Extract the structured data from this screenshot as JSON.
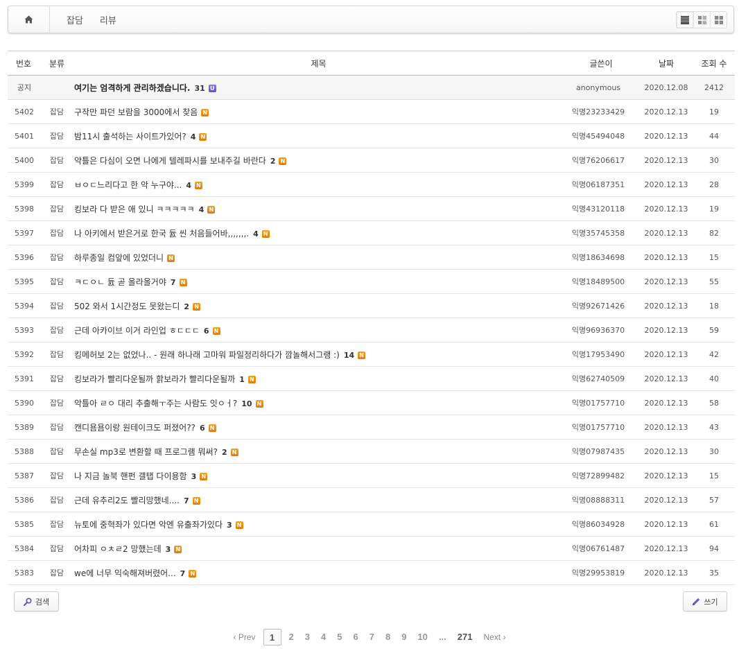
{
  "nav": {
    "home_icon": "home-icon",
    "categories": [
      "잡담",
      "리뷰"
    ],
    "view_modes": [
      {
        "name": "list-view",
        "icon": "list-icon",
        "active": true
      },
      {
        "name": "webzine-view",
        "icon": "webzine-icon",
        "active": false
      },
      {
        "name": "gallery-view",
        "icon": "gallery-icon",
        "active": false
      }
    ]
  },
  "table": {
    "headers": {
      "num": "번호",
      "category": "분류",
      "title": "제목",
      "author": "글쓴이",
      "date": "날짜",
      "views": "조회 수"
    },
    "notice": {
      "num": "공지",
      "category": "",
      "title": "여기는 엄격하게 관리하겠습니다.",
      "comments": "31",
      "badge": "U",
      "author": "anonymous",
      "date": "2020.12.08",
      "views": "2412"
    },
    "rows": [
      {
        "num": "5402",
        "category": "잡담",
        "title": "구작만 파던 보람을 3000에서 찾음",
        "comments": "",
        "badge": "N",
        "author": "익명23233429",
        "date": "2020.12.13",
        "views": "19"
      },
      {
        "num": "5401",
        "category": "잡담",
        "title": "밤11시 출석하는 사이트가있어?",
        "comments": "4",
        "badge": "N",
        "author": "익명45494048",
        "date": "2020.12.13",
        "views": "44"
      },
      {
        "num": "5400",
        "category": "잡담",
        "title": "악틀은 다심이 오면 나에게 텔레파시를 보내주길 바란다",
        "comments": "2",
        "badge": "N",
        "author": "익명76206617",
        "date": "2020.12.13",
        "views": "30"
      },
      {
        "num": "5399",
        "category": "잡담",
        "title": "ㅂㅇㄷ느리다고 한 악 누구야...",
        "comments": "4",
        "badge": "N",
        "author": "익명06187351",
        "date": "2020.12.13",
        "views": "28"
      },
      {
        "num": "5398",
        "category": "잡담",
        "title": "킹보라 다 받은 애 있니 ㅋㅋㅋㅋㅋ",
        "comments": "4",
        "badge": "N",
        "author": "익명43120118",
        "date": "2020.12.13",
        "views": "19"
      },
      {
        "num": "5397",
        "category": "잡담",
        "title": "나 아키에서 받은거로 한국 듌 씬 처음들어바,,,,,,,.",
        "comments": "4",
        "badge": "N",
        "author": "익명35745358",
        "date": "2020.12.13",
        "views": "82"
      },
      {
        "num": "5396",
        "category": "잡담",
        "title": "하루종일 컴앞에 있었더니",
        "comments": "",
        "badge": "N",
        "author": "익명18634698",
        "date": "2020.12.13",
        "views": "15"
      },
      {
        "num": "5395",
        "category": "잡담",
        "title": "ㅋㄷㅇㄴ 듌 곧 올라올거야",
        "comments": "7",
        "badge": "N",
        "author": "익명18489500",
        "date": "2020.12.13",
        "views": "55"
      },
      {
        "num": "5394",
        "category": "잡담",
        "title": "502 와서 1시간정도 못왔는디",
        "comments": "2",
        "badge": "N",
        "author": "익명92671426",
        "date": "2020.12.13",
        "views": "18"
      },
      {
        "num": "5393",
        "category": "잡담",
        "title": "근데 아카이브 이거 라인업 ㅎㄷㄷㄷ",
        "comments": "6",
        "badge": "N",
        "author": "익명96936370",
        "date": "2020.12.13",
        "views": "59"
      },
      {
        "num": "5392",
        "category": "잡담",
        "title": "킹메허보 2는 없었나.. - 원래 하나래 고마워 파일정리하다가 깜놀해서그랭 :)",
        "comments": "14",
        "badge": "N",
        "author": "익명17953490",
        "date": "2020.12.13",
        "views": "42"
      },
      {
        "num": "5391",
        "category": "잡담",
        "title": "킹보라가 빨리다운될까 핡보라가 빨리다운될까",
        "comments": "1",
        "badge": "N",
        "author": "익명62740509",
        "date": "2020.12.13",
        "views": "40"
      },
      {
        "num": "5390",
        "category": "잡담",
        "title": "악틀아 ㄹㅇ 대리 추출해ㅜ주는 사람도 잇ㅇㅓ?",
        "comments": "10",
        "badge": "N",
        "author": "익명01757710",
        "date": "2020.12.13",
        "views": "58"
      },
      {
        "num": "5389",
        "category": "잡담",
        "title": "캔디욤욤이랑 원테이크도 퍼졌어??",
        "comments": "6",
        "badge": "N",
        "author": "익명01757710",
        "date": "2020.12.13",
        "views": "43"
      },
      {
        "num": "5388",
        "category": "잡담",
        "title": "무손실 mp3로 변환할 때 프로그램 뭐써?",
        "comments": "2",
        "badge": "N",
        "author": "익명07987435",
        "date": "2020.12.13",
        "views": "30"
      },
      {
        "num": "5387",
        "category": "잡담",
        "title": "나 지금 놀북 핸펀 갤탭 다이용함",
        "comments": "3",
        "badge": "N",
        "author": "익명72899482",
        "date": "2020.12.13",
        "views": "15"
      },
      {
        "num": "5386",
        "category": "잡담",
        "title": "근데 유추리2도 빨리망했네....",
        "comments": "7",
        "badge": "N",
        "author": "익명08888311",
        "date": "2020.12.13",
        "views": "57"
      },
      {
        "num": "5385",
        "category": "잡담",
        "title": "뉴토에 중혁좌가 있다면 악엔 유출좌가있다",
        "comments": "3",
        "badge": "N",
        "author": "익명86034928",
        "date": "2020.12.13",
        "views": "61"
      },
      {
        "num": "5384",
        "category": "잡담",
        "title": "어차피 ㅇㅊㄹ2 망했는데",
        "comments": "3",
        "badge": "N",
        "author": "익명06761487",
        "date": "2020.12.13",
        "views": "94"
      },
      {
        "num": "5383",
        "category": "잡담",
        "title": "we에 너무 익숙해져버렸어...",
        "comments": "7",
        "badge": "N",
        "author": "익명29953819",
        "date": "2020.12.13",
        "views": "35"
      }
    ]
  },
  "buttons": {
    "search": {
      "label": "검색",
      "icon": "search-icon"
    },
    "write": {
      "label": "쓰기",
      "icon": "pencil-icon"
    }
  },
  "pagination": {
    "prev": "‹ Prev",
    "pages": [
      "1",
      "2",
      "3",
      "4",
      "5",
      "6",
      "7",
      "8",
      "9",
      "10"
    ],
    "current": "1",
    "ellipsis": "...",
    "last": "271",
    "next": "Next ›"
  },
  "colors": {
    "badge_new": "#f08c12",
    "badge_update": "#7463d4",
    "notice_row_bg": "#f6f6f6"
  }
}
